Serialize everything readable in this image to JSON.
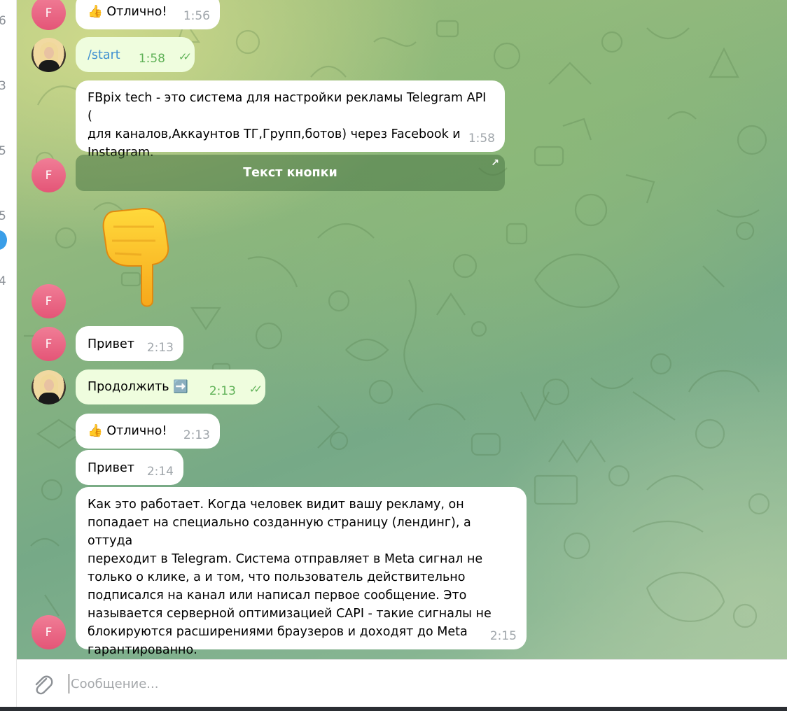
{
  "sidebar_strip": {
    "numbers": [
      "6",
      "3",
      "5",
      "5",
      "4"
    ]
  },
  "avatars": {
    "bot_letter": "F"
  },
  "messages": {
    "m1": {
      "text": "Отлично!",
      "emoji": "👍",
      "time": "1:56"
    },
    "m2": {
      "text": "/start",
      "time": "1:58"
    },
    "m3": {
      "text": "FBpix tech - это система для настройки рекламы Telegram API (\nдля каналов,Аккаунтов ТГ,Групп,ботов)  через Facebook и\nInstagram.",
      "time": "1:58"
    },
    "m3_button": {
      "label": "Текст кнопки"
    },
    "m4": {
      "sticker": "pointing-down-hand",
      "emoji": "👇"
    },
    "m5": {
      "text": "Привет",
      "time": "2:13"
    },
    "m6": {
      "text": "Продолжить",
      "emoji": "➡️",
      "time": "2:13"
    },
    "m7": {
      "text": "Отлично!",
      "emoji": "👍",
      "time": "2:13"
    },
    "m8": {
      "text": "Привет",
      "time": "2:14"
    },
    "m9": {
      "text": "Как это работает. Когда человек видит вашу рекламу, он\nпопадает на специально созданную страницу (лендинг), а оттуда\nпереходит в Telegram. Система отправляет в Meta сигнал не\nтолько о клике, а и том, что пользователь действительно\nподписался на канал или написал первое сообщение. Это\nназывается серверной оптимизацией CAPI - такие сигналы не\nблокируются расширениями браузеров и доходят до Meta\nгарантированно.",
      "time": "2:15"
    }
  },
  "composer": {
    "placeholder": "Сообщение..."
  },
  "colors": {
    "incoming_bubble": "#ffffff",
    "outgoing_bubble": "#effdde",
    "avatar_pink": "#e8607f",
    "check_green": "#5fb157"
  }
}
